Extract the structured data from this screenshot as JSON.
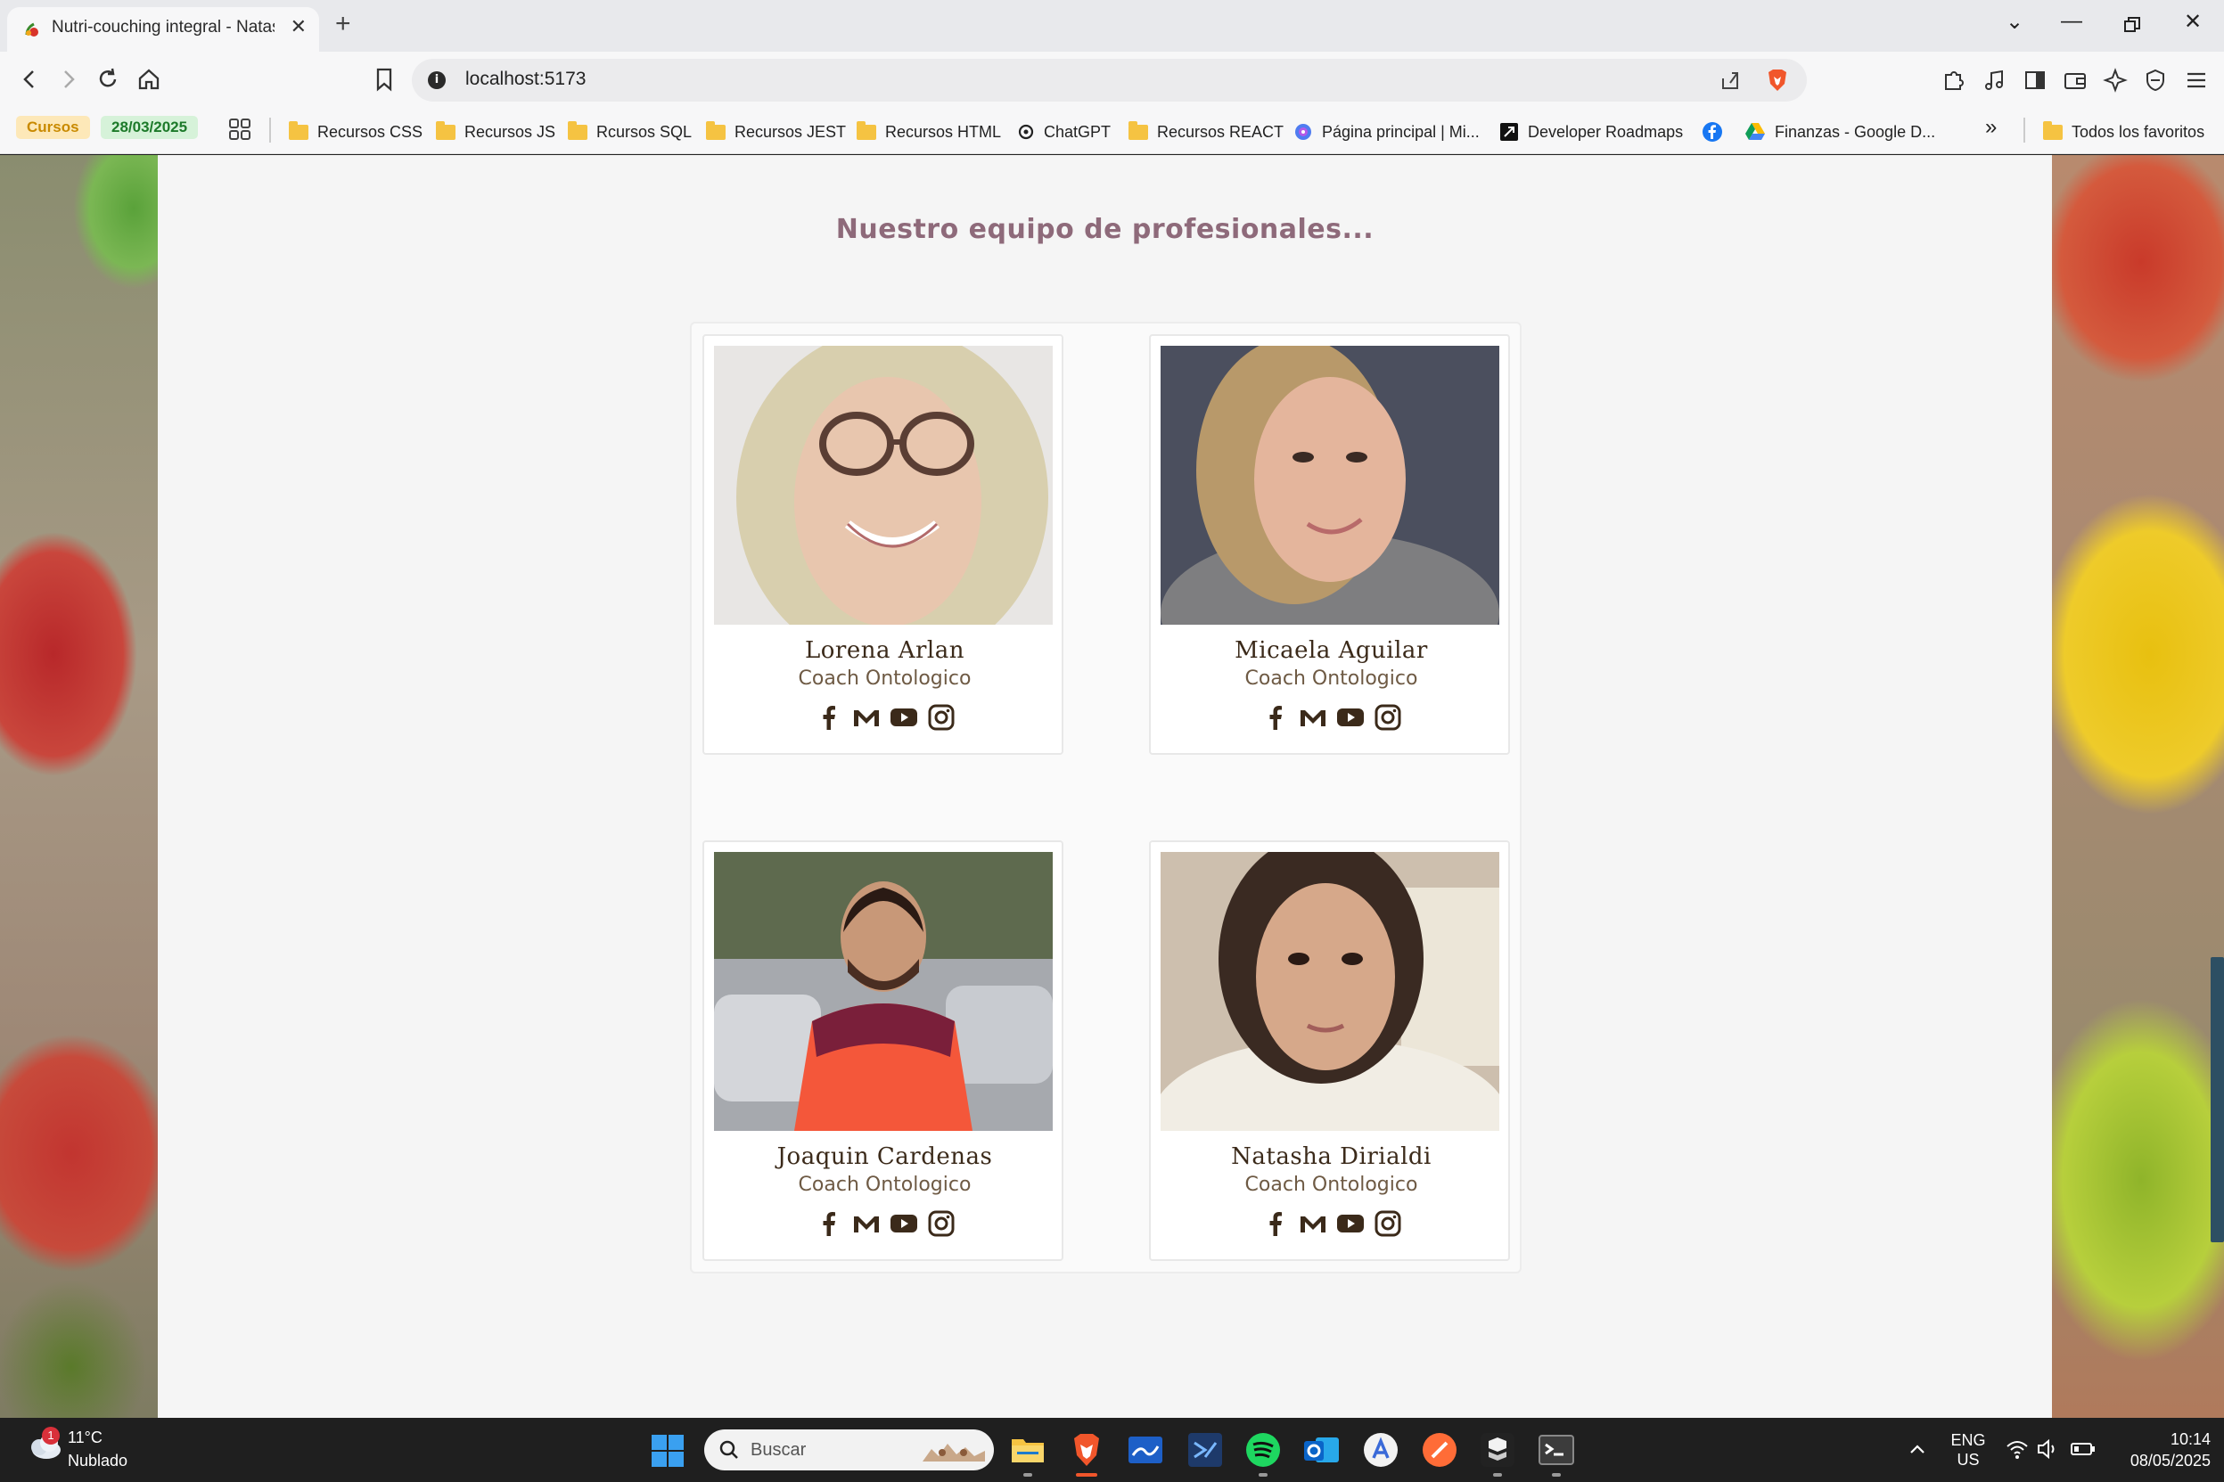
{
  "browser": {
    "tab_title": "Nutri-couching integral - Natasha",
    "new_tab": "+",
    "url": "localhost:5173"
  },
  "bookmarks": {
    "chip_cursos": "Cursos",
    "chip_date": "28/03/2025",
    "items": [
      {
        "label": "Recursos CSS",
        "icon": "folder-icon"
      },
      {
        "label": "Recursos JS",
        "icon": "folder-icon"
      },
      {
        "label": "Rcursos SQL",
        "icon": "folder-icon"
      },
      {
        "label": "Recursos JEST",
        "icon": "folder-icon"
      },
      {
        "label": "Recursos HTML",
        "icon": "folder-icon"
      },
      {
        "label": "ChatGPT",
        "icon": "chatgpt-icon"
      },
      {
        "label": "Recursos REACT",
        "icon": "folder-icon"
      },
      {
        "label": "Página principal | Mi...",
        "icon": "copilot-icon"
      },
      {
        "label": "Developer Roadmaps",
        "icon": "roadmap-icon"
      },
      {
        "label": "",
        "icon": "facebook-icon"
      },
      {
        "label": "Finanzas - Google D...",
        "icon": "google-drive-icon"
      }
    ],
    "overflow": "»",
    "all_favorites": "Todos los favoritos"
  },
  "page": {
    "section_title": "Nuestro equipo de profesionales...",
    "team": [
      {
        "name": "Lorena Arlan",
        "role": "Coach Ontologico",
        "photo": "lorena-photo"
      },
      {
        "name": "Micaela Aguilar",
        "role": "Coach Ontologico",
        "photo": "micaela-photo"
      },
      {
        "name": "Joaquin Cardenas",
        "role": "Coach Ontologico",
        "photo": "joaquin-photo"
      },
      {
        "name": "Natasha Dirialdi",
        "role": "Coach Ontologico",
        "photo": "natasha-photo"
      }
    ],
    "social_icons": [
      "facebook-icon",
      "gmail-icon",
      "youtube-icon",
      "instagram-icon"
    ]
  },
  "taskbar": {
    "weather_badge": "1",
    "weather_temp": "11°C",
    "weather_desc": "Nublado",
    "search_placeholder": "Buscar",
    "lang_line1": "ENG",
    "lang_line2": "US",
    "time": "10:14",
    "date": "08/05/2025"
  },
  "colors": {
    "section_title": "#8e6a7a",
    "name_text": "#3b2a1a",
    "role_text": "#6e5a44",
    "page_bg": "#f5f5f5"
  }
}
